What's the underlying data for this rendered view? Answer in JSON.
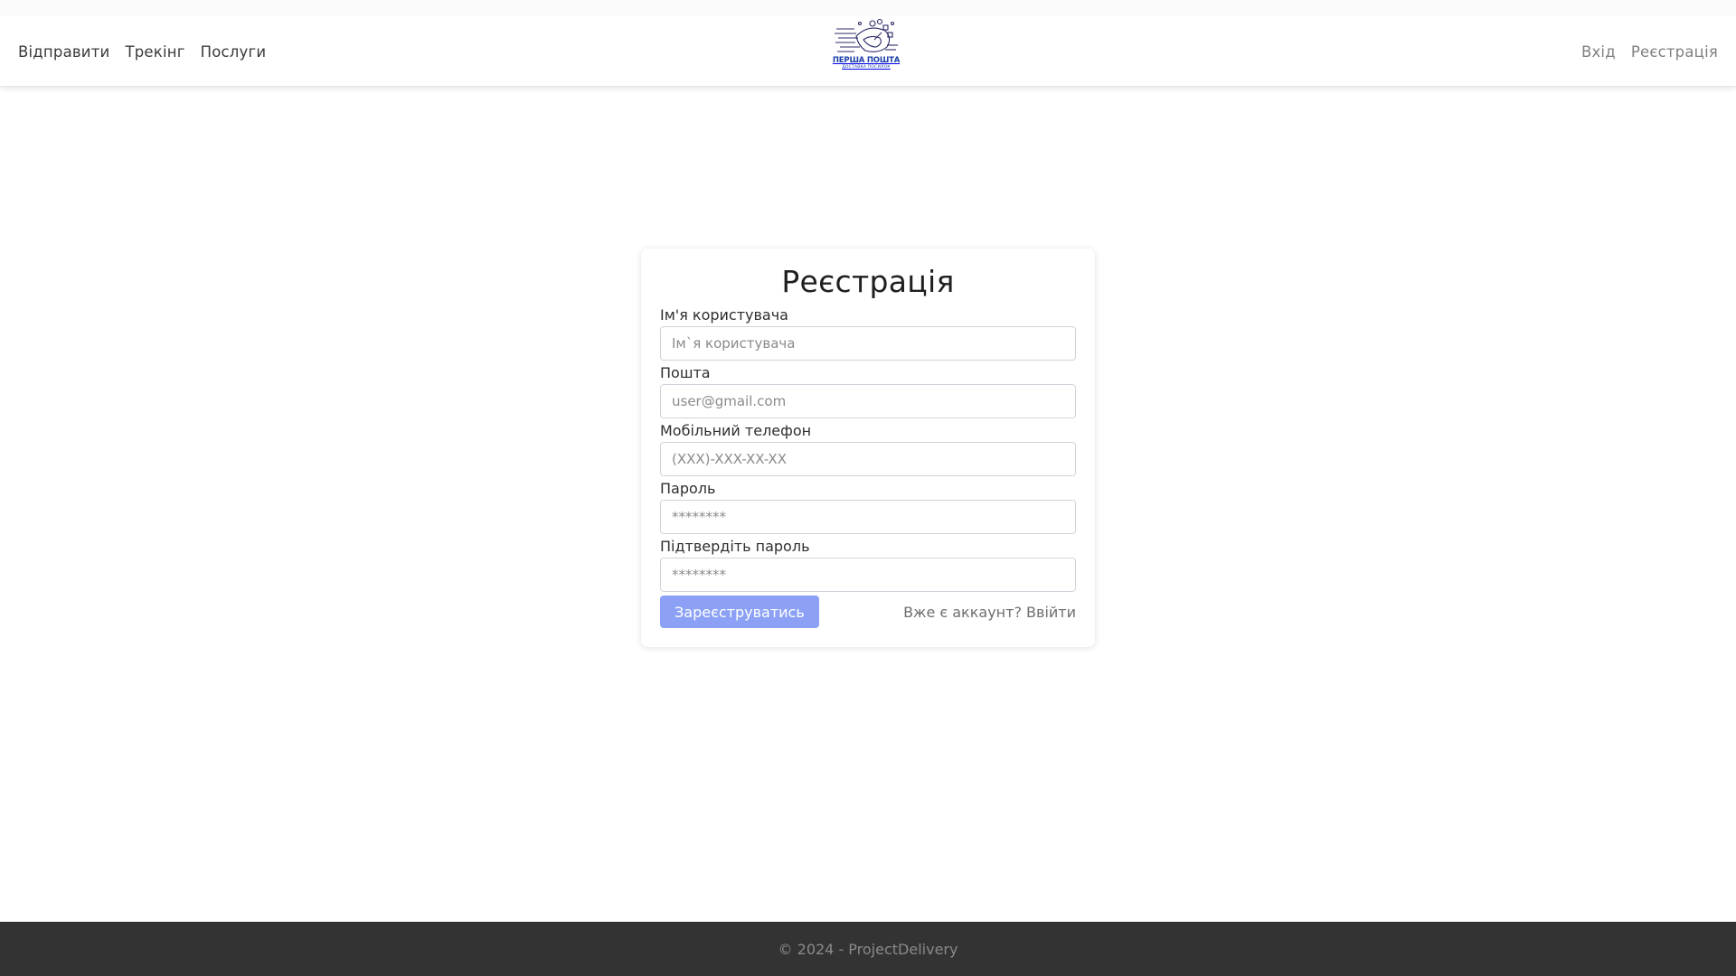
{
  "nav": {
    "left": [
      "Відправити",
      "Трекінг",
      "Послуги"
    ],
    "right": [
      "Вхід",
      "Реєстрація"
    ],
    "logo": {
      "title": "ПЕРША ПОШТА",
      "subtitle": "ДОСТАВКА ПОСИЛОК",
      "icon": "delivery-logo-icon"
    }
  },
  "form": {
    "title": "Реєстрація",
    "fields": [
      {
        "label": "Ім'я користувача",
        "placeholder": "Ім`я користувача",
        "type": "text"
      },
      {
        "label": "Пошта",
        "placeholder": "user@gmail.com",
        "type": "email"
      },
      {
        "label": "Мобільний телефон",
        "placeholder": "(XXX)-XXX-XX-XX",
        "type": "tel"
      },
      {
        "label": "Пароль",
        "placeholder": "********",
        "type": "password"
      },
      {
        "label": "Підтвердіть пароль",
        "placeholder": "********",
        "type": "password"
      }
    ],
    "submit_label": "Зареєструватись",
    "login_prompt": "Вже є аккаунт?",
    "login_link": "Ввійти"
  },
  "footer": {
    "text": "© 2024 - ProjectDelivery"
  },
  "colors": {
    "primary_button": "#8ca1f5",
    "footer_bg": "#333333",
    "logo_blue": "#1a3fa8"
  }
}
